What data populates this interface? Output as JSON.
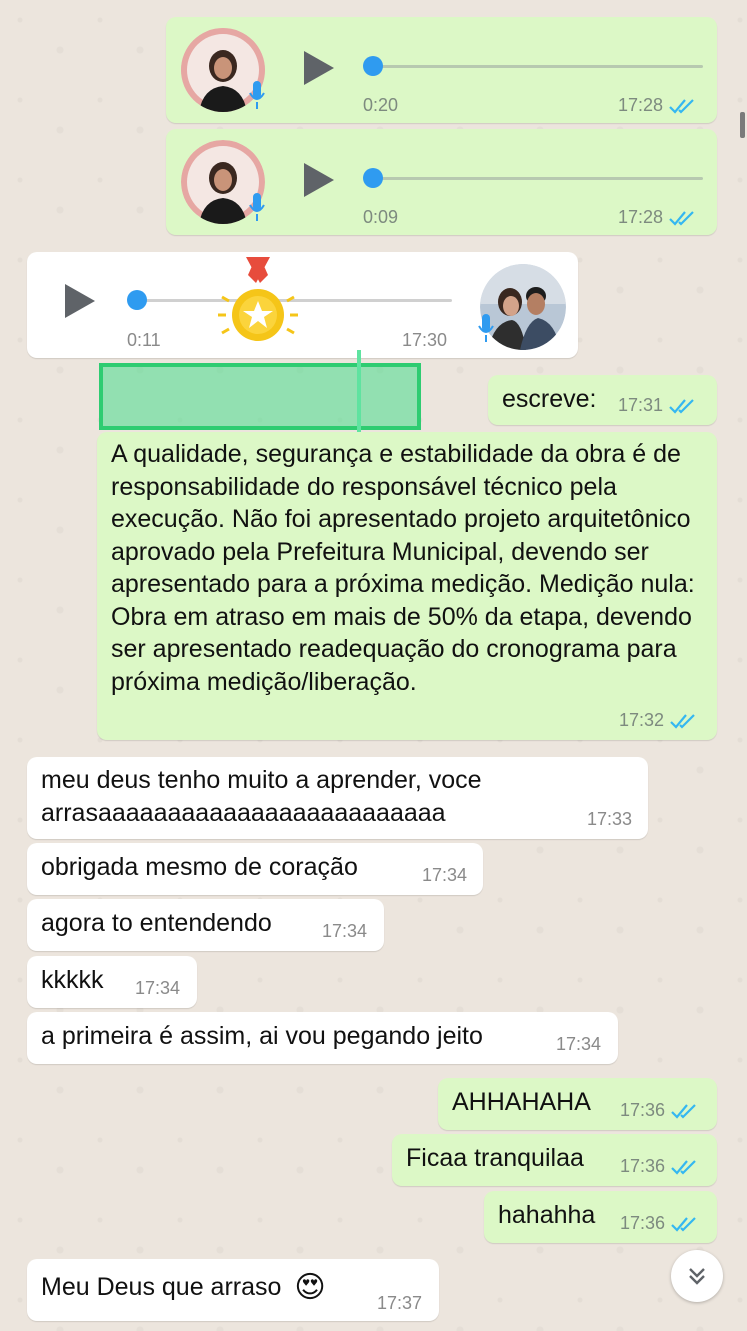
{
  "colors": {
    "chat_background": "#ece5dd",
    "outgoing_bubble": "#dcf8c6",
    "incoming_bubble": "#ffffff",
    "read_ticks": "#34b7f1",
    "audio_progress": "#2f9bf0",
    "highlight_box": "#2ecc71"
  },
  "voice_notes": [
    {
      "direction": "outgoing",
      "duration": "0:20",
      "time": "17:28",
      "status": "read",
      "icon": "play-icon"
    },
    {
      "direction": "outgoing",
      "duration": "0:09",
      "time": "17:28",
      "status": "read",
      "icon": "play-icon"
    },
    {
      "direction": "incoming",
      "duration": "0:11",
      "time": "17:30",
      "icon": "play-icon",
      "overlay_sticker": "medal-icon"
    }
  ],
  "messages": [
    {
      "direction": "outgoing",
      "text": "escreve:",
      "time": "17:31",
      "status": "read"
    },
    {
      "direction": "outgoing",
      "text": "A qualidade, segurança e estabilidade da obra é de responsabilidade do responsável técnico pela execução. Não foi apresentado projeto arquitetônico aprovado pela Prefeitura Municipal, devendo ser apresentado para a próxima medição. Medição nula: Obra em atraso em mais de 50% da etapa, devendo ser apresentado readequação do cronograma para próxima medição/liberação.",
      "time": "17:32",
      "status": "read"
    },
    {
      "direction": "incoming",
      "text": "meu deus tenho muito a aprender, voce arrasaaaaaaaaaaaaaaaaaaaaaaaaa",
      "time": "17:33"
    },
    {
      "direction": "incoming",
      "text": "obrigada mesmo de coração",
      "time": "17:34"
    },
    {
      "direction": "incoming",
      "text": "agora to entendendo",
      "time": "17:34"
    },
    {
      "direction": "incoming",
      "text": "kkkkk",
      "time": "17:34"
    },
    {
      "direction": "incoming",
      "text": "a primeira é assim, ai vou pegando jeito",
      "time": "17:34"
    },
    {
      "direction": "outgoing",
      "text": "AHHAHAHA",
      "time": "17:36",
      "status": "read"
    },
    {
      "direction": "outgoing",
      "text": "Ficaa tranquilaa",
      "time": "17:36",
      "status": "read"
    },
    {
      "direction": "outgoing",
      "text": "hahahha",
      "time": "17:36",
      "status": "read"
    },
    {
      "direction": "incoming",
      "text": "Meu Deus que arraso",
      "emoji": "😍",
      "time": "17:37"
    }
  ],
  "scroll_to_bottom": {
    "icon": "double-chevron-down-icon"
  }
}
